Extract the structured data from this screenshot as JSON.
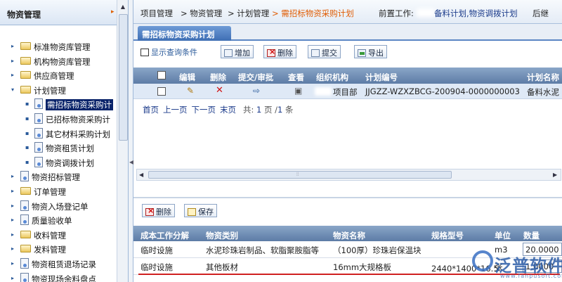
{
  "left": {
    "title": "物资管理",
    "collapse_glyph": "▸",
    "tree": [
      {
        "label": "标准物资库管理",
        "icon": "folder",
        "level": 0
      },
      {
        "label": "机构物资库管理",
        "icon": "folder",
        "level": 0
      },
      {
        "label": "供应商管理",
        "icon": "folder",
        "level": 0
      },
      {
        "label": "计划管理",
        "icon": "folder",
        "level": 0,
        "expanded": true
      },
      {
        "label": "需招标物资采购计",
        "icon": "doc",
        "level": 1,
        "selected": true
      },
      {
        "label": "已招标物资采购计",
        "icon": "doc",
        "level": 1
      },
      {
        "label": "其它材料采购计划",
        "icon": "doc",
        "level": 1
      },
      {
        "label": "物资租赁计划",
        "icon": "doc",
        "level": 1
      },
      {
        "label": "物资调拨计划",
        "icon": "doc",
        "level": 1
      },
      {
        "label": "物资招标管理",
        "icon": "doc",
        "level": 0
      },
      {
        "label": "订单管理",
        "icon": "folder",
        "level": 0
      },
      {
        "label": "物资入场登记单",
        "icon": "doc",
        "level": 0
      },
      {
        "label": "质量验收单",
        "icon": "doc",
        "level": 0
      },
      {
        "label": "收料管理",
        "icon": "folder",
        "level": 0
      },
      {
        "label": "发料管理",
        "icon": "folder",
        "level": 0
      },
      {
        "label": "物资租赁退场记录",
        "icon": "doc",
        "level": 0
      },
      {
        "label": "物资现场余料盘点",
        "icon": "doc",
        "level": 0
      }
    ]
  },
  "breadcrumb": {
    "items": [
      "项目管理",
      "> 物资管理",
      "> 计划管理",
      ">  需招标物资采购计划"
    ],
    "prev_label": "前置工作:",
    "prev_value": "备料计划,物资调拨计划",
    "next_label": "后继"
  },
  "tab": {
    "label": "需招标物资采购计划"
  },
  "toolbar": {
    "query": "显示查询条件",
    "add": "增加",
    "delete": "删除",
    "submit": "提交",
    "export": "导出"
  },
  "grid1": {
    "headers": [
      "编辑",
      "删除",
      "提交/审批",
      "查看",
      "组织机构",
      "计划编号",
      "计划名称"
    ],
    "row": {
      "org": "项目部",
      "plan_no": "JJGZZ-WZXZBCG-200904-0000000003",
      "plan_name": "备料水泥"
    }
  },
  "pager": {
    "first": "首页",
    "prev": "上一页",
    "next": "下一页",
    "last": "末页",
    "total_prefix": "共:",
    "pages": "1",
    "page_unit": "页",
    "slash": "/",
    "records": "1",
    "record_unit": "条"
  },
  "toolbar2": {
    "delete": "删除",
    "save": "保存"
  },
  "grid2": {
    "headers": [
      "成本工作分解",
      "物资类别",
      "物资名称",
      "规格型号",
      "单位",
      "数量"
    ],
    "rows": [
      {
        "wbs": "临时设施",
        "category": "水泥珍珠岩制品、软脂聚胺脂等",
        "name": "（100厚）珍珠岩保温块",
        "spec": "",
        "unit": "m3",
        "qty": "20.0000"
      },
      {
        "wbs": "临时设施",
        "category": "其他板材",
        "name": "16mm大规格板",
        "spec": "2440*1400*16.5",
        "unit": "张",
        "qty": "1.0000"
      }
    ]
  },
  "watermark": {
    "brand": "泛普软件",
    "site": "www.fanpusoft.com"
  },
  "colors": {
    "accent": "#3f6fb4",
    "header": "#5d7ca6",
    "current": "#e05a00",
    "underline": "#d02020"
  }
}
